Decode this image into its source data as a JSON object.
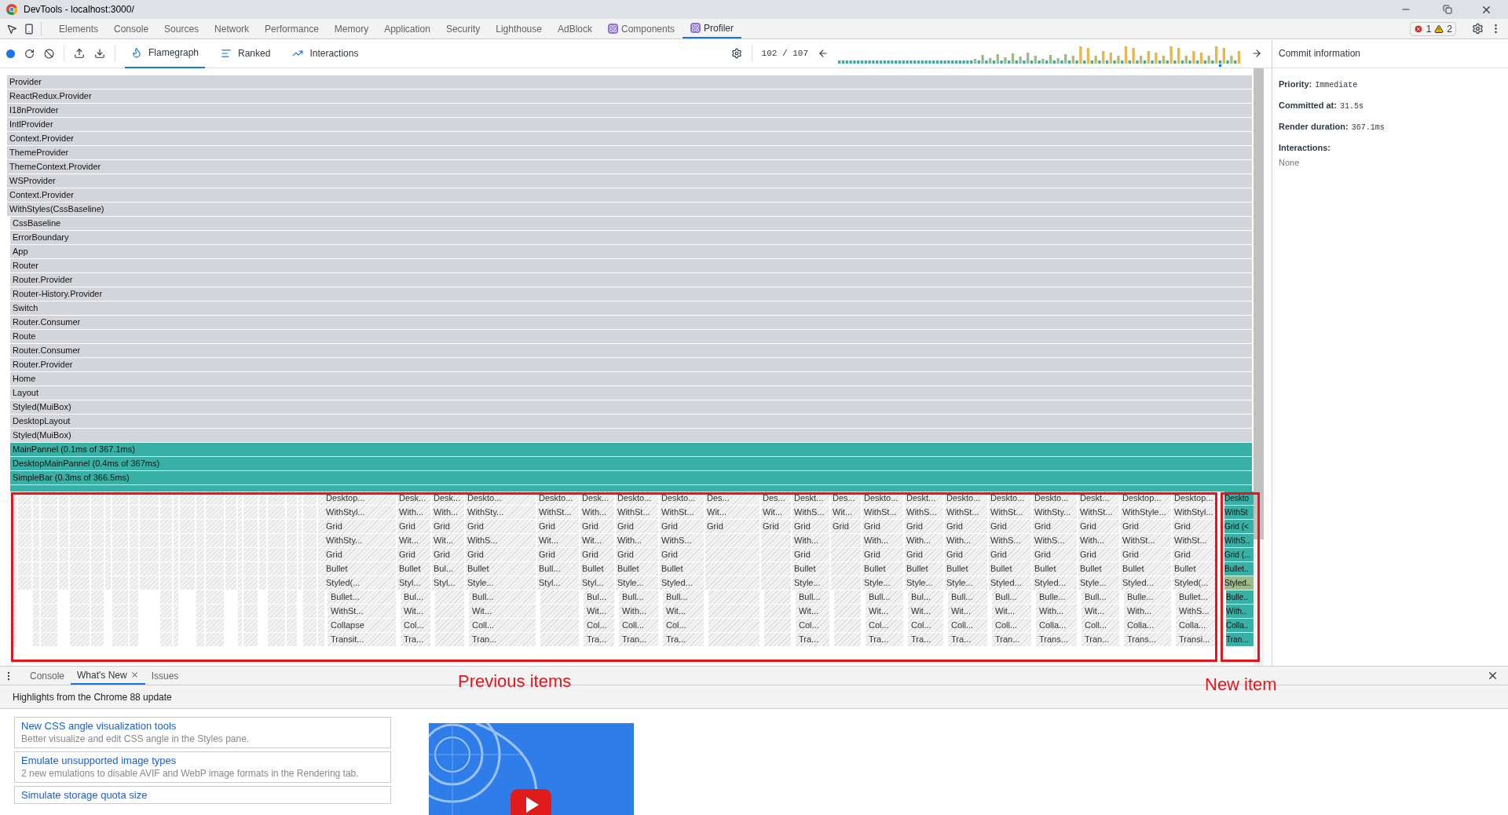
{
  "window": {
    "title": "DevTools - localhost:3000/"
  },
  "devtools_tabs": [
    {
      "label": "Elements",
      "selected": false,
      "kind": "text"
    },
    {
      "label": "Console",
      "selected": false,
      "kind": "text"
    },
    {
      "label": "Sources",
      "selected": false,
      "kind": "text"
    },
    {
      "label": "Network",
      "selected": false,
      "kind": "text"
    },
    {
      "label": "Performance",
      "selected": false,
      "kind": "text"
    },
    {
      "label": "Memory",
      "selected": false,
      "kind": "text"
    },
    {
      "label": "Application",
      "selected": false,
      "kind": "text"
    },
    {
      "label": "Security",
      "selected": false,
      "kind": "text"
    },
    {
      "label": "Lighthouse",
      "selected": false,
      "kind": "text"
    },
    {
      "label": "AdBlock",
      "selected": false,
      "kind": "text"
    },
    {
      "label": "Components",
      "selected": false,
      "kind": "react"
    },
    {
      "label": "Profiler",
      "selected": true,
      "kind": "react"
    }
  ],
  "issue_counts": {
    "errors": "1",
    "warnings": "2"
  },
  "profiler_toolbar": {
    "views": [
      {
        "label": "Flamegraph",
        "selected": true,
        "kind": "flame"
      },
      {
        "label": "Ranked",
        "selected": false,
        "kind": "ranked"
      },
      {
        "label": "Interactions",
        "selected": false,
        "kind": "interactions"
      }
    ],
    "commit_counter": "102 / 107"
  },
  "flamegraph": {
    "rows": [
      {
        "label": "Provider",
        "color": "#d4d5da"
      },
      {
        "label": "ReactRedux.Provider",
        "color": "#d4d5da"
      },
      {
        "label": "I18nProvider",
        "color": "#d4d5da"
      },
      {
        "label": "IntlProvider",
        "color": "#d4d5da"
      },
      {
        "label": "Context.Provider",
        "color": "#d4d5da"
      },
      {
        "label": "ThemeProvider",
        "color": "#d4d5da"
      },
      {
        "label": "ThemeContext.Provider",
        "color": "#d4d5da"
      },
      {
        "label": "WSProvider",
        "color": "#d4d5da"
      },
      {
        "label": "Context.Provider",
        "color": "#d4d5da"
      },
      {
        "label": "WithStyles(CssBaseline)",
        "color": "#d4d5da"
      },
      {
        "label": "CssBaseline",
        "color": "#d4d5da"
      },
      {
        "label": "ErrorBoundary",
        "color": "#d4d5da"
      },
      {
        "label": "App",
        "color": "#d4d5da"
      },
      {
        "label": "Router",
        "color": "#d4d5da"
      },
      {
        "label": "Router.Provider",
        "color": "#d4d5da"
      },
      {
        "label": "Router-History.Provider",
        "color": "#d4d5da"
      },
      {
        "label": "Switch",
        "color": "#d4d5da"
      },
      {
        "label": "Router.Consumer",
        "color": "#d4d5da"
      },
      {
        "label": "Route",
        "color": "#d4d5da"
      },
      {
        "label": "Router.Consumer",
        "color": "#d4d5da"
      },
      {
        "label": "Router.Provider",
        "color": "#d4d5da"
      },
      {
        "label": "Home",
        "color": "#d4d5da"
      },
      {
        "label": "Layout",
        "color": "#d4d5da"
      },
      {
        "label": "Styled(MuiBox)",
        "color": "#d4d5da"
      },
      {
        "label": "DesktopLayout",
        "color": "#d4d5da"
      },
      {
        "label": "Styled(MuiBox)",
        "color": "#d4d5da"
      },
      {
        "label": "MainPannel (0.1ms of 367.1ms)",
        "color": "#37b1a5"
      },
      {
        "label": "DesktopMainPannel (0.4ms of 367ms)",
        "color": "#37b1a5"
      },
      {
        "label": "SimpleBar (0.3ms of 366.5ms)",
        "color": "#37b1a5"
      }
    ],
    "stacks": [
      {
        "labels": [
          "Desktop...",
          "WithStyl...",
          "Grid",
          "WithSty...",
          "Grid",
          "Bullet",
          "Styled(...",
          "Bullet...",
          "WithSt...",
          "Collapse",
          "Transit..."
        ]
      },
      {
        "labels": [
          "Desk...",
          "With...",
          "Grid",
          "Wit...",
          "Grid",
          "Bullet",
          "Styl...",
          "Bul...",
          "Wit...",
          "Col...",
          "Tra..."
        ]
      },
      {
        "labels": [
          "Desk...",
          "With...",
          "Grid",
          "Wit...",
          "Grid",
          "Bul...",
          "Styl..."
        ]
      },
      {
        "labels": [
          "Deskto...",
          "WithSty...",
          "Grid",
          "WithS...",
          "Grid",
          "Bullet",
          "Style...",
          "Bull...",
          "Wit...",
          "Coll...",
          "Tran..."
        ]
      },
      {
        "labels": [
          "Deskto...",
          "WithSt...",
          "Grid",
          "Wit...",
          "Grid",
          "Bull...",
          "Styl..."
        ]
      },
      {
        "labels": [
          "Desk...",
          "With...",
          "Grid",
          "Wit...",
          "Grid",
          "Bullet",
          "Styl...",
          "Bul...",
          "Wit...",
          "Col...",
          "Tra..."
        ]
      },
      {
        "labels": [
          "Deskto...",
          "WithSt...",
          "Grid",
          "With...",
          "Grid",
          "Bullet",
          "Style...",
          "Bull...",
          "With...",
          "Coll...",
          "Tran..."
        ]
      },
      {
        "labels": [
          "Deskto...",
          "WithSt...",
          "Grid",
          "WithS...",
          "Grid",
          "Bullet",
          "Styled...",
          "Bull...",
          "Wit...",
          "Col...",
          "Tra..."
        ]
      },
      {
        "labels": [
          "Des...",
          "Wit...",
          "Grid"
        ]
      },
      {
        "labels": [
          "Des...",
          "Wit...",
          "Grid"
        ]
      },
      {
        "labels": [
          "Deskt...",
          "WithS...",
          "Grid",
          "With...",
          "Grid",
          "Bullet",
          "Style...",
          "Bull...",
          "Wit...",
          "Col...",
          "Tra..."
        ]
      },
      {
        "labels": [
          "Des...",
          "Wit...",
          "Grid"
        ]
      },
      {
        "labels": [
          "Deskto...",
          "WithSt...",
          "Grid",
          "With...",
          "Grid",
          "Bullet",
          "Style...",
          "Bull...",
          "Wit...",
          "Col...",
          "Tra..."
        ]
      },
      {
        "labels": [
          "Deskt...",
          "WithS...",
          "Grid",
          "With...",
          "Grid",
          "Bullet",
          "Style...",
          "Bul...",
          "Wit...",
          "Col...",
          "Tra..."
        ]
      },
      {
        "labels": [
          "Deskto...",
          "WithSt...",
          "Grid",
          "With...",
          "Grid",
          "Bullet",
          "Style...",
          "Bull...",
          "Wit...",
          "Coll...",
          "Tra..."
        ]
      },
      {
        "labels": [
          "Deskto...",
          "WithSt...",
          "Grid",
          "WithS...",
          "Grid",
          "Bullet",
          "Styled...",
          "Bull...",
          "Wit...",
          "Coll...",
          "Tran..."
        ]
      },
      {
        "labels": [
          "Deskto...",
          "WithSty...",
          "Grid",
          "WithS...",
          "Grid",
          "Bullet",
          "Styled...",
          "Bulle...",
          "With...",
          "Colla...",
          "Trans..."
        ]
      },
      {
        "labels": [
          "Deskt...",
          "WithSt...",
          "Grid",
          "With...",
          "Grid",
          "Bullet",
          "Style...",
          "Bull...",
          "Wit...",
          "Coll...",
          "Tran..."
        ]
      },
      {
        "labels": [
          "Desktop...",
          "WithStyle...",
          "Grid",
          "WithSt...",
          "Grid",
          "Bullet",
          "Styled...",
          "Bulle...",
          "With...",
          "Colla...",
          "Trans..."
        ]
      },
      {
        "labels": [
          "Desktop...",
          "WithStyl...",
          "Grid",
          "WithSt...",
          "Grid",
          "Bullet",
          "Styled(...",
          "Bullet...",
          "WithS...",
          "Colla...",
          "Transi..."
        ]
      }
    ],
    "new_stack": {
      "cells": [
        {
          "label": "Deskto",
          "color": "#37b1a5"
        },
        {
          "label": "WithSt",
          "color": "#37b1a5"
        },
        {
          "label": "Grid (<",
          "color": "#37b1a5"
        },
        {
          "label": "WithS..",
          "color": "#37b1a5"
        },
        {
          "label": "Grid (...",
          "color": "#37b1a5"
        },
        {
          "label": "Bullet..",
          "color": "#37b1a5"
        },
        {
          "label": "Styled..",
          "color": "#9dbb8a"
        },
        {
          "label": "Bulle..",
          "color": "#37b1a5"
        },
        {
          "label": "With..",
          "color": "#37b1a5"
        },
        {
          "label": "Colla..",
          "color": "#37b1a5"
        },
        {
          "label": "Tran...",
          "color": "#37b1a5"
        }
      ]
    }
  },
  "annotations": [
    {
      "label": "Previous items",
      "kind": "previous"
    },
    {
      "label": "New item",
      "kind": "new"
    }
  ],
  "commit_information": {
    "title": "Commit information",
    "fields": [
      {
        "label": "Priority:",
        "value": "Immediate"
      },
      {
        "label": "Committed at:",
        "value": "31.5s"
      },
      {
        "label": "Render duration:",
        "value": "367.1ms"
      }
    ],
    "interactions_label": "Interactions:",
    "interactions_value": "None"
  },
  "drawer": {
    "tabs": [
      {
        "label": "Console",
        "selected": false,
        "closable": false
      },
      {
        "label": "What's New",
        "selected": true,
        "closable": true
      },
      {
        "label": "Issues",
        "selected": false,
        "closable": false
      }
    ],
    "heading": "Highlights from the Chrome 88 update",
    "cards": [
      {
        "title": "New CSS angle visualization tools",
        "description": "Better visualize and edit CSS angle in the Styles pane."
      },
      {
        "title": "Emulate unsupported image types",
        "description": "2 new emulations to disable AVIF and WebP image formats in the Rendering tab."
      },
      {
        "title": "Simulate storage quota size"
      }
    ]
  }
}
